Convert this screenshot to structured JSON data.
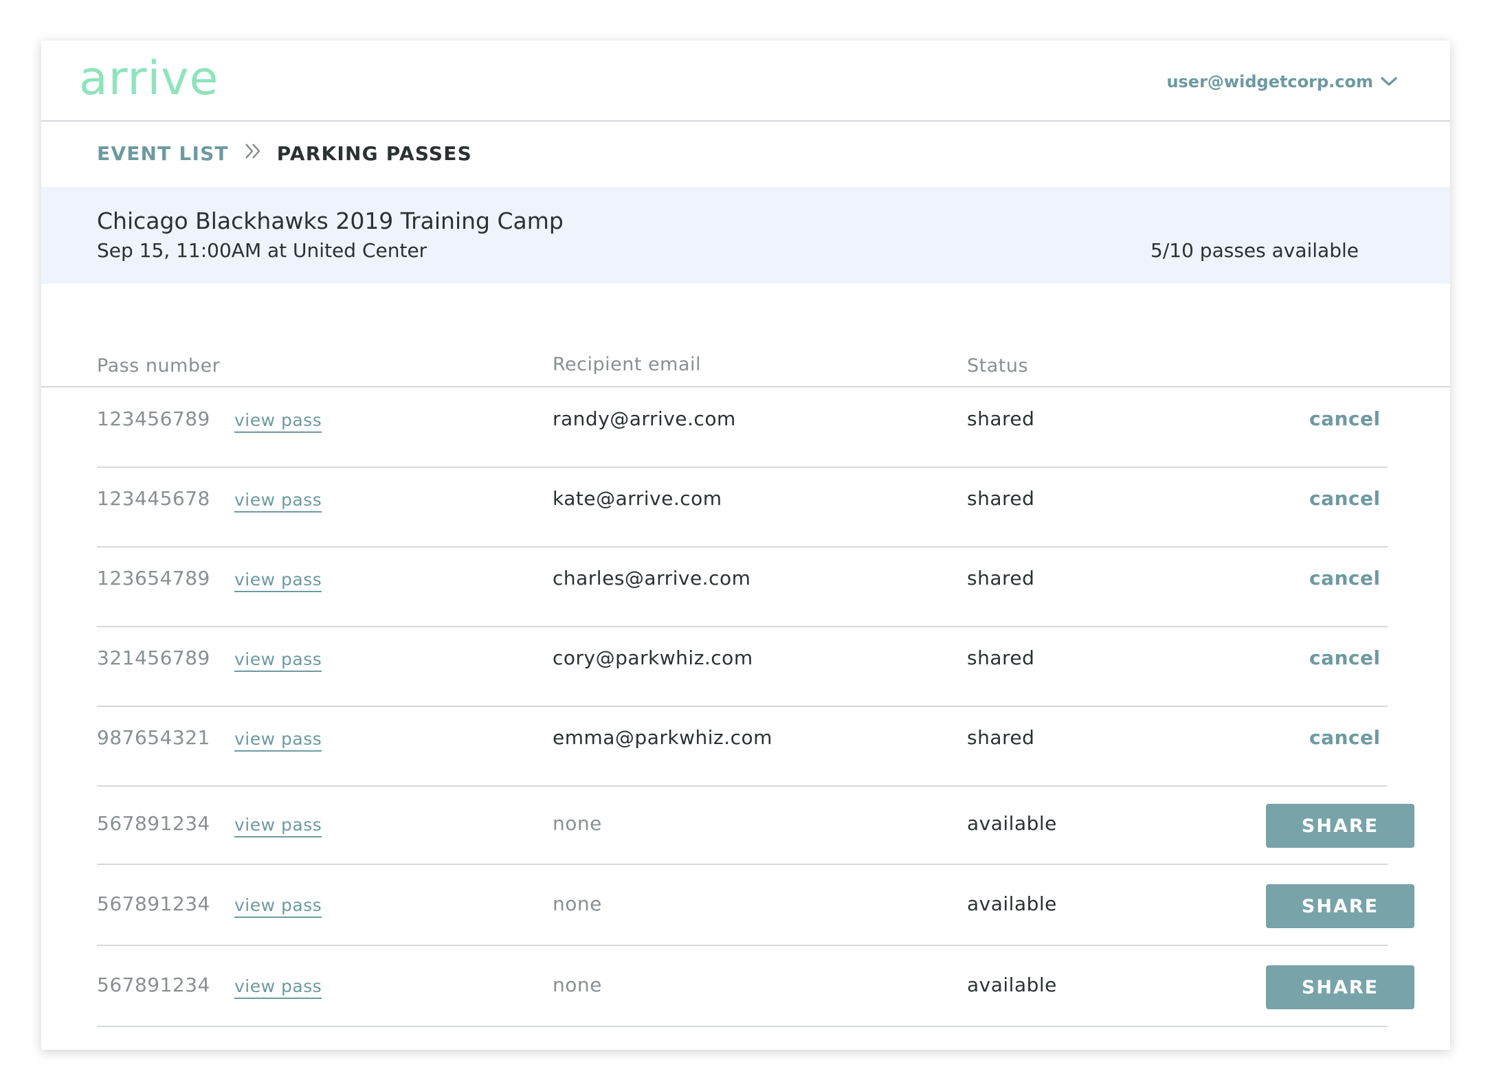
{
  "header": {
    "logo_text": "arrive",
    "user_email": "user@widgetcorp.com"
  },
  "breadcrumb": {
    "parent": "EVENT LIST",
    "current": "PARKING PASSES"
  },
  "event": {
    "title": "Chicago Blackhawks 2019 Training Camp",
    "subtitle": "Sep 15, 11:00AM at United Center",
    "availability": "5/10 passes available"
  },
  "table": {
    "headers": {
      "pass_number": "Pass number",
      "recipient_email": "Recipient email",
      "status": "Status"
    },
    "rows": [
      {
        "number": "123456789",
        "view": "view pass",
        "email": "randy@arrive.com",
        "status": "shared",
        "action": "cancel"
      },
      {
        "number": "123445678",
        "view": "view pass",
        "email": "kate@arrive.com",
        "status": "shared",
        "action": "cancel"
      },
      {
        "number": "123654789",
        "view": "view pass",
        "email": "charles@arrive.com",
        "status": "shared",
        "action": "cancel"
      },
      {
        "number": "321456789",
        "view": "view pass",
        "email": "cory@parkwhiz.com",
        "status": "shared",
        "action": "cancel"
      },
      {
        "number": "987654321",
        "view": "view pass",
        "email": "emma@parkwhiz.com",
        "status": "shared",
        "action": "cancel"
      },
      {
        "number": "567891234",
        "view": "view pass",
        "email": "none",
        "status": "available",
        "action": "SHARE"
      },
      {
        "number": "567891234",
        "view": "view pass",
        "email": "none",
        "status": "available",
        "action": "SHARE"
      },
      {
        "number": "567891234",
        "view": "view pass",
        "email": "none",
        "status": "available",
        "action": "SHARE"
      }
    ]
  },
  "colors": {
    "logo": "#8fe3bd",
    "accent": "#6d9aa0",
    "share_button": "#77a3a9",
    "banner": "#eff3fb"
  },
  "icons": {
    "user_menu": "chevron-down-icon",
    "breadcrumb_separator": "double-chevron-right-icon"
  }
}
